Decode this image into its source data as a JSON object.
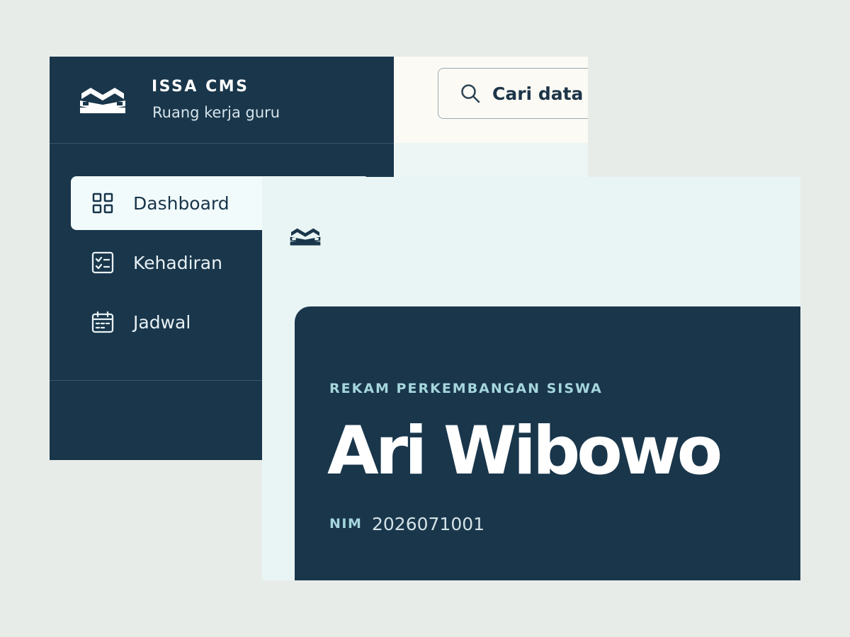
{
  "app": {
    "name": "ISSA CMS",
    "subtitle": "Ruang kerja guru",
    "logo_icon": "open-book-icon"
  },
  "sidebar": {
    "items": [
      {
        "label": "Dashboard",
        "icon": "grid-icon",
        "active": true
      },
      {
        "label": "Kehadiran",
        "icon": "checklist-icon",
        "active": false
      },
      {
        "label": "Jadwal",
        "icon": "calendar-icon",
        "active": false
      }
    ]
  },
  "search": {
    "text": "Cari data si",
    "icon": "search-icon"
  },
  "profile": {
    "eyebrow": "REKAM PERKEMBANGAN SISWA",
    "name": "Ari Wibowo",
    "id_label": "NIM",
    "id_value": "2026071001"
  },
  "colors": {
    "navy": "#19364b",
    "accent_teal": "#a6d6dd",
    "background": "#e8ece9",
    "active_item": "#f2fbfb"
  }
}
